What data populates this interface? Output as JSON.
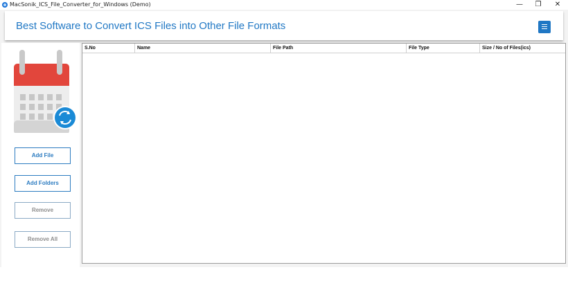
{
  "window": {
    "title": "MacSonik_ICS_File_Converter_for_Windows (Demo)",
    "minimize_glyph": "—",
    "maximize_glyph": "❐",
    "close_glyph": "✕"
  },
  "header": {
    "title": "Best Software to Convert ICS Files into Other File Formats",
    "menu_icon": "hamburger-menu-icon"
  },
  "sidebar": {
    "logo_icon": "calendar-sync-icon",
    "buttons": [
      {
        "label": "Add File",
        "enabled": true
      },
      {
        "label": "Add Folders",
        "enabled": true
      },
      {
        "label": "Remove",
        "enabled": false
      },
      {
        "label": "Remove All",
        "enabled": false
      }
    ]
  },
  "table": {
    "columns": [
      "S.No",
      "Name",
      "File Path",
      "File Type",
      "Size / No of Files(ics)"
    ],
    "rows": []
  },
  "colors": {
    "accent": "#1f77c4",
    "calendar_red": "#e2463c",
    "sync_blue": "#1a8ad6"
  }
}
